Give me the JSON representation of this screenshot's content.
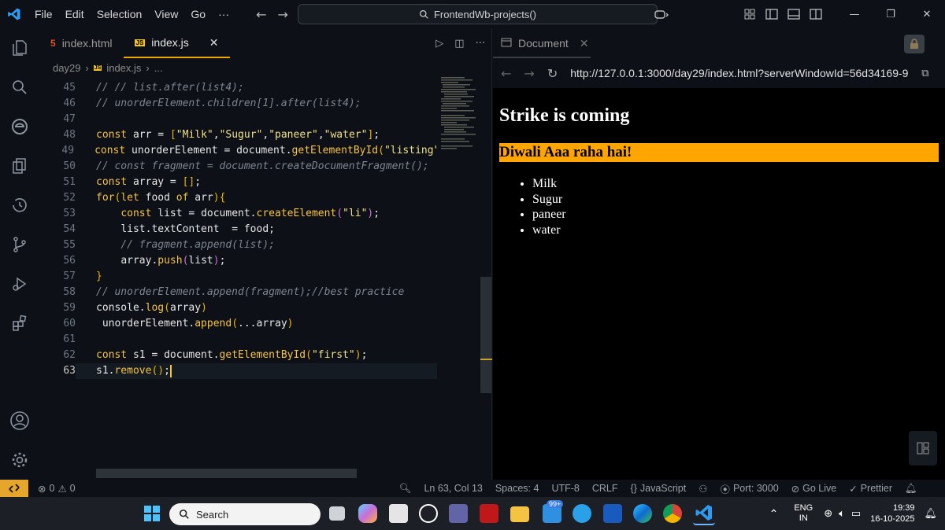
{
  "menu": [
    "File",
    "Edit",
    "Selection",
    "View",
    "Go",
    "···"
  ],
  "command_center": "FrontendWb-projects()",
  "editor": {
    "tabs": [
      {
        "label": "index.html",
        "active": false
      },
      {
        "label": "index.js",
        "active": true
      }
    ],
    "breadcrumb": [
      "day29",
      "index.js",
      "..."
    ],
    "lines": [
      {
        "n": "45",
        "html": "<span class=\"cm\">// // list.after(list4);</span>"
      },
      {
        "n": "46",
        "html": "<span class=\"cm\">// unorderElement.children[1].after(list4);</span>"
      },
      {
        "n": "47",
        "html": ""
      },
      {
        "n": "48",
        "html": "<span class=\"kw\">const</span> <span class=\"pl\">arr</span> <span class=\"pl\">=</span> <span class=\"br1\">[</span><span class=\"str\">\"Milk\"</span><span class=\"pl\">,</span><span class=\"str\">\"Sugur\"</span><span class=\"pl\">,</span><span class=\"str\">\"paneer\"</span><span class=\"pl\">,</span><span class=\"str\">\"water\"</span><span class=\"br1\">]</span><span class=\"pl\">;</span>"
      },
      {
        "n": "49",
        "html": "<span class=\"kw\">const</span> <span class=\"pl\">unorderElement = document.</span><span class=\"fn\">getElementById</span><span class=\"br1\">(</span><span class=\"str\">\"listing\");</span>"
      },
      {
        "n": "50",
        "html": "<span class=\"cm\">// const fragment = document.createDocumentFragment();</span>"
      },
      {
        "n": "51",
        "html": "<span class=\"kw\">const</span> <span class=\"pl\">array = </span><span class=\"br1\">[]</span><span class=\"pl\">;</span>"
      },
      {
        "n": "52",
        "html": "<span class=\"kw\">for</span><span class=\"br1\">(</span><span class=\"kw\">let</span> <span class=\"pl\">food</span> <span class=\"kw\">of</span> <span class=\"pl\">arr</span><span class=\"br1\">)</span><span class=\"br1\">{</span>"
      },
      {
        "n": "53",
        "html": "    <span class=\"kw\">const</span> <span class=\"pl\">list = document.</span><span class=\"fn\">createElement</span><span class=\"br2\">(</span><span class=\"str\">\"li\"</span><span class=\"br2\">)</span><span class=\"pl\">;</span>"
      },
      {
        "n": "54",
        "html": "    <span class=\"pl\">list.textContent  = food;</span>"
      },
      {
        "n": "55",
        "html": "    <span class=\"cm\">// fragment.append(list);</span>"
      },
      {
        "n": "56",
        "html": "    <span class=\"pl\">array.</span><span class=\"fn\">push</span><span class=\"br2\">(</span><span class=\"pl\">list</span><span class=\"br2\">)</span><span class=\"pl\">;</span>"
      },
      {
        "n": "57",
        "html": "<span class=\"br1\">}</span>"
      },
      {
        "n": "58",
        "html": "<span class=\"cm\">// unorderElement.append(fragment);//best practice</span>"
      },
      {
        "n": "59",
        "html": "<span class=\"pl\">console.</span><span class=\"fn\">log</span><span class=\"br1\">(</span><span class=\"pl\">array</span><span class=\"br1\">)</span>"
      },
      {
        "n": "60",
        "html": " <span class=\"pl\">unorderElement.</span><span class=\"fn\">append</span><span class=\"br1\">(</span><span class=\"pl\">...array</span><span class=\"br1\">)</span>"
      },
      {
        "n": "61",
        "html": ""
      },
      {
        "n": "62",
        "html": "<span class=\"kw\">const</span> <span class=\"pl\">s1 = document.</span><span class=\"fn\">getElementById</span><span class=\"br1\">(</span><span class=\"str\">\"first\"</span><span class=\"br1\">)</span><span class=\"pl\">;</span>"
      },
      {
        "n": "63",
        "html": "<span class=\"pl\">s1.</span><span class=\"fn\">remove</span><span class=\"br1\">()</span><span class=\"pl\">;</span><span class=\"cursor\"></span>"
      }
    ]
  },
  "browser": {
    "tab_title": "Document",
    "url": "http://127.0.0.1:3000/day29/index.html?serverWindowId=56d34169-9",
    "page": {
      "heading": "Strike is coming",
      "subheading": "Diwali Aaa raha hai!",
      "items": [
        "Milk",
        "Sugur",
        "paneer",
        "water"
      ]
    }
  },
  "status": {
    "errors": "0",
    "warnings": "0",
    "position": "Ln 63, Col 13",
    "spaces": "Spaces: 4",
    "encoding": "UTF-8",
    "eol": "CRLF",
    "language": "JavaScript",
    "port": "Port: 3000",
    "golive": "Go Live",
    "prettier": "Prettier"
  },
  "taskbar": {
    "search_placeholder": "Search",
    "badge": "99+",
    "lang_top": "ENG",
    "lang_bottom": "IN",
    "time": "19:39",
    "date": "16-10-2025"
  },
  "colors": {
    "accent": "#f0a500",
    "orange_header": "#ffa500",
    "vscode_blue": "#2f9bf0"
  }
}
